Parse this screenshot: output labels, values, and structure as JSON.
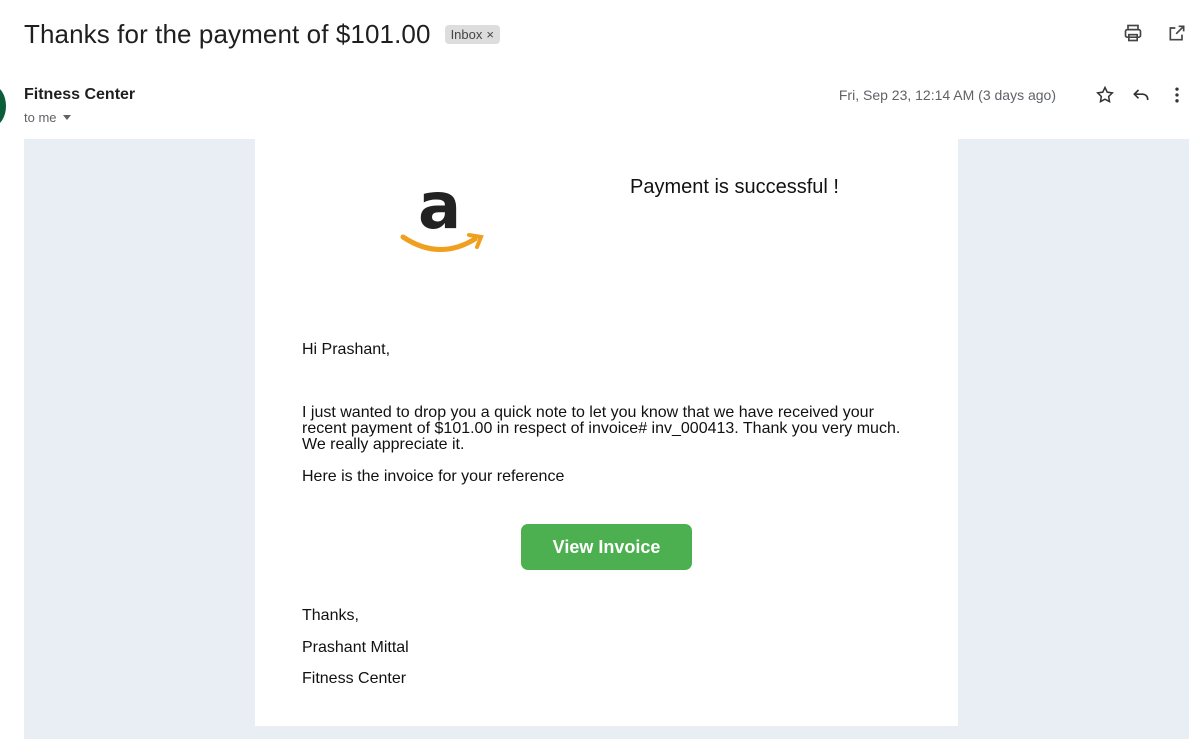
{
  "header": {
    "subject": "Thanks for the payment of $101.00",
    "label": "Inbox",
    "label_remove": "×",
    "icons": [
      "print-icon",
      "open-in-new-window-icon"
    ]
  },
  "message": {
    "sender_name": "Fitness Center",
    "recipient": "to me",
    "date": "Fri, Sep 23, 12:14 AM (3 days ago)",
    "actions": [
      "star-icon",
      "reply-icon",
      "more-vertical-icon"
    ]
  },
  "email_body": {
    "logo": "amazon-logo",
    "logo_letter": "a",
    "headline": "Payment is successful !",
    "greeting": "Hi Prashant,",
    "paragraph": "I just wanted to drop you a quick note to let you know that we have received your recent payment of $101.00 in respect of invoice# inv_000413. Thank you very much. We really appreciate it.",
    "reference": "Here is the invoice for your reference",
    "button_label": "View Invoice",
    "closing": "Thanks,",
    "signature_name": "Prashant Mittal",
    "signature_org": "Fitness Center"
  },
  "colors": {
    "button": "#4caf50",
    "email_background": "#e9eef5",
    "avatar": "#0b5d3b",
    "amazon_smile": "#f0a01e"
  }
}
